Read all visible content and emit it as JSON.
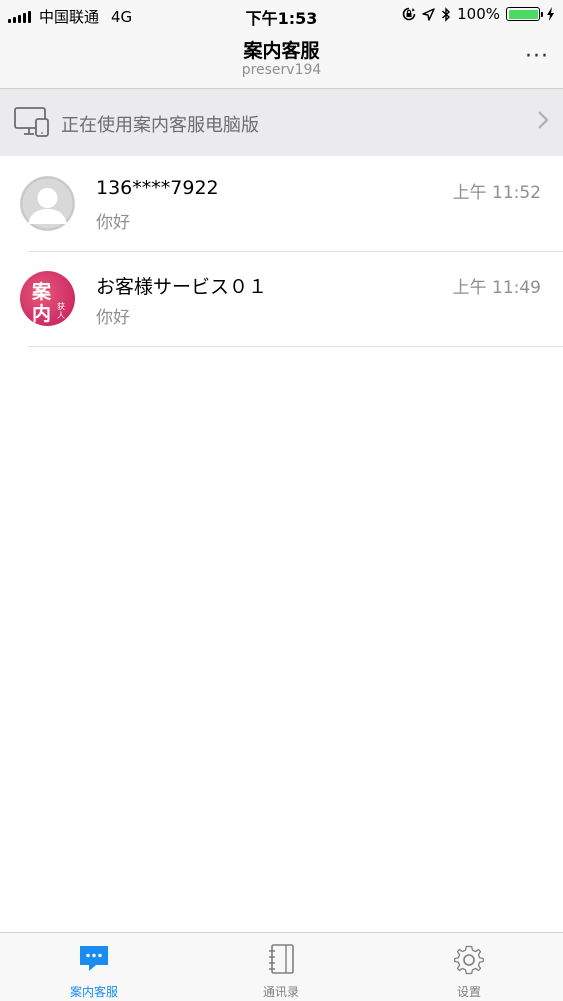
{
  "status_bar": {
    "carrier": "中国联通",
    "network": "4G",
    "time": "下午1:53",
    "battery": "100%",
    "battery_level": 1.0,
    "icons": [
      "signal-icon",
      "orientation-lock-icon",
      "location-icon",
      "bluetooth-icon",
      "battery-icon",
      "charging-icon"
    ]
  },
  "nav": {
    "title": "案内客服",
    "subtitle": "preserv194",
    "more_label": "···"
  },
  "banner": {
    "text": "正在使用案内客服电脑版",
    "icon": "desktop-icon"
  },
  "conversations": [
    {
      "name": "136****7922",
      "time": "上午 11:52",
      "preview": "你好",
      "avatar": "default-user-avatar"
    },
    {
      "name": "お客様サービス０１",
      "time": "上午 11:49",
      "preview": "你好",
      "avatar": "brand-avatar",
      "avatar_text": {
        "line1": "案",
        "line2": "内",
        "small": "获人"
      }
    }
  ],
  "tabs": [
    {
      "label": "案内客服",
      "icon": "chat-bubble-icon",
      "active": true
    },
    {
      "label": "通讯录",
      "icon": "contacts-book-icon",
      "active": false
    },
    {
      "label": "设置",
      "icon": "gear-icon",
      "active": false
    }
  ],
  "colors": {
    "accent": "#1a8cf0",
    "battery_green": "#4cd964",
    "secondary_text": "#8e8e93",
    "banner_bg": "#ebebed",
    "brand_avatar": "#d63a64"
  }
}
